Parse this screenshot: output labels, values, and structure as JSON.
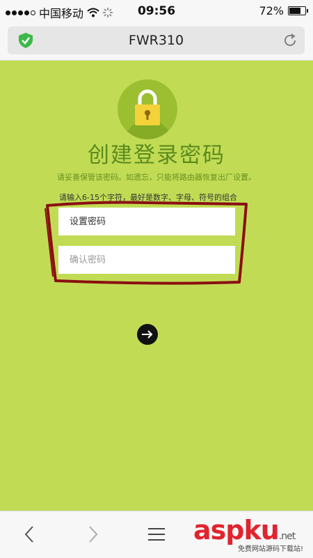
{
  "status_bar": {
    "carrier": "中国移动",
    "time": "09:56",
    "battery": "72%",
    "battery_level": 0.72
  },
  "address_bar": {
    "title": "FWR310",
    "security_icon": "green-shield-check-icon",
    "reload_icon": "reload-icon"
  },
  "page": {
    "lock_icon": "padlock-icon",
    "headline": "创建登录密码",
    "subline": "请妥善保管该密码。如遗忘，只能将路由器恢复出厂设置。",
    "hint": "请输入6-15个字符，最好是数字、字母、符号的组合",
    "password_placeholder": "设置密码",
    "confirm_placeholder": "确认密码",
    "next_icon": "arrow-right-icon"
  },
  "toolbar": {
    "back_icon": "chevron-left-icon",
    "forward_icon": "chevron-right-icon",
    "menu_icon": "hamburger-menu-icon"
  },
  "watermark": {
    "main": "asp",
    "suffix": "ku",
    "domain": ".net",
    "tagline": "免费网站源码下载站!"
  },
  "colors": {
    "page_background": "#c1dc54",
    "headline": "#5c8a1e",
    "annotation_outline": "#8a0f12",
    "watermark": "#e0242e"
  }
}
